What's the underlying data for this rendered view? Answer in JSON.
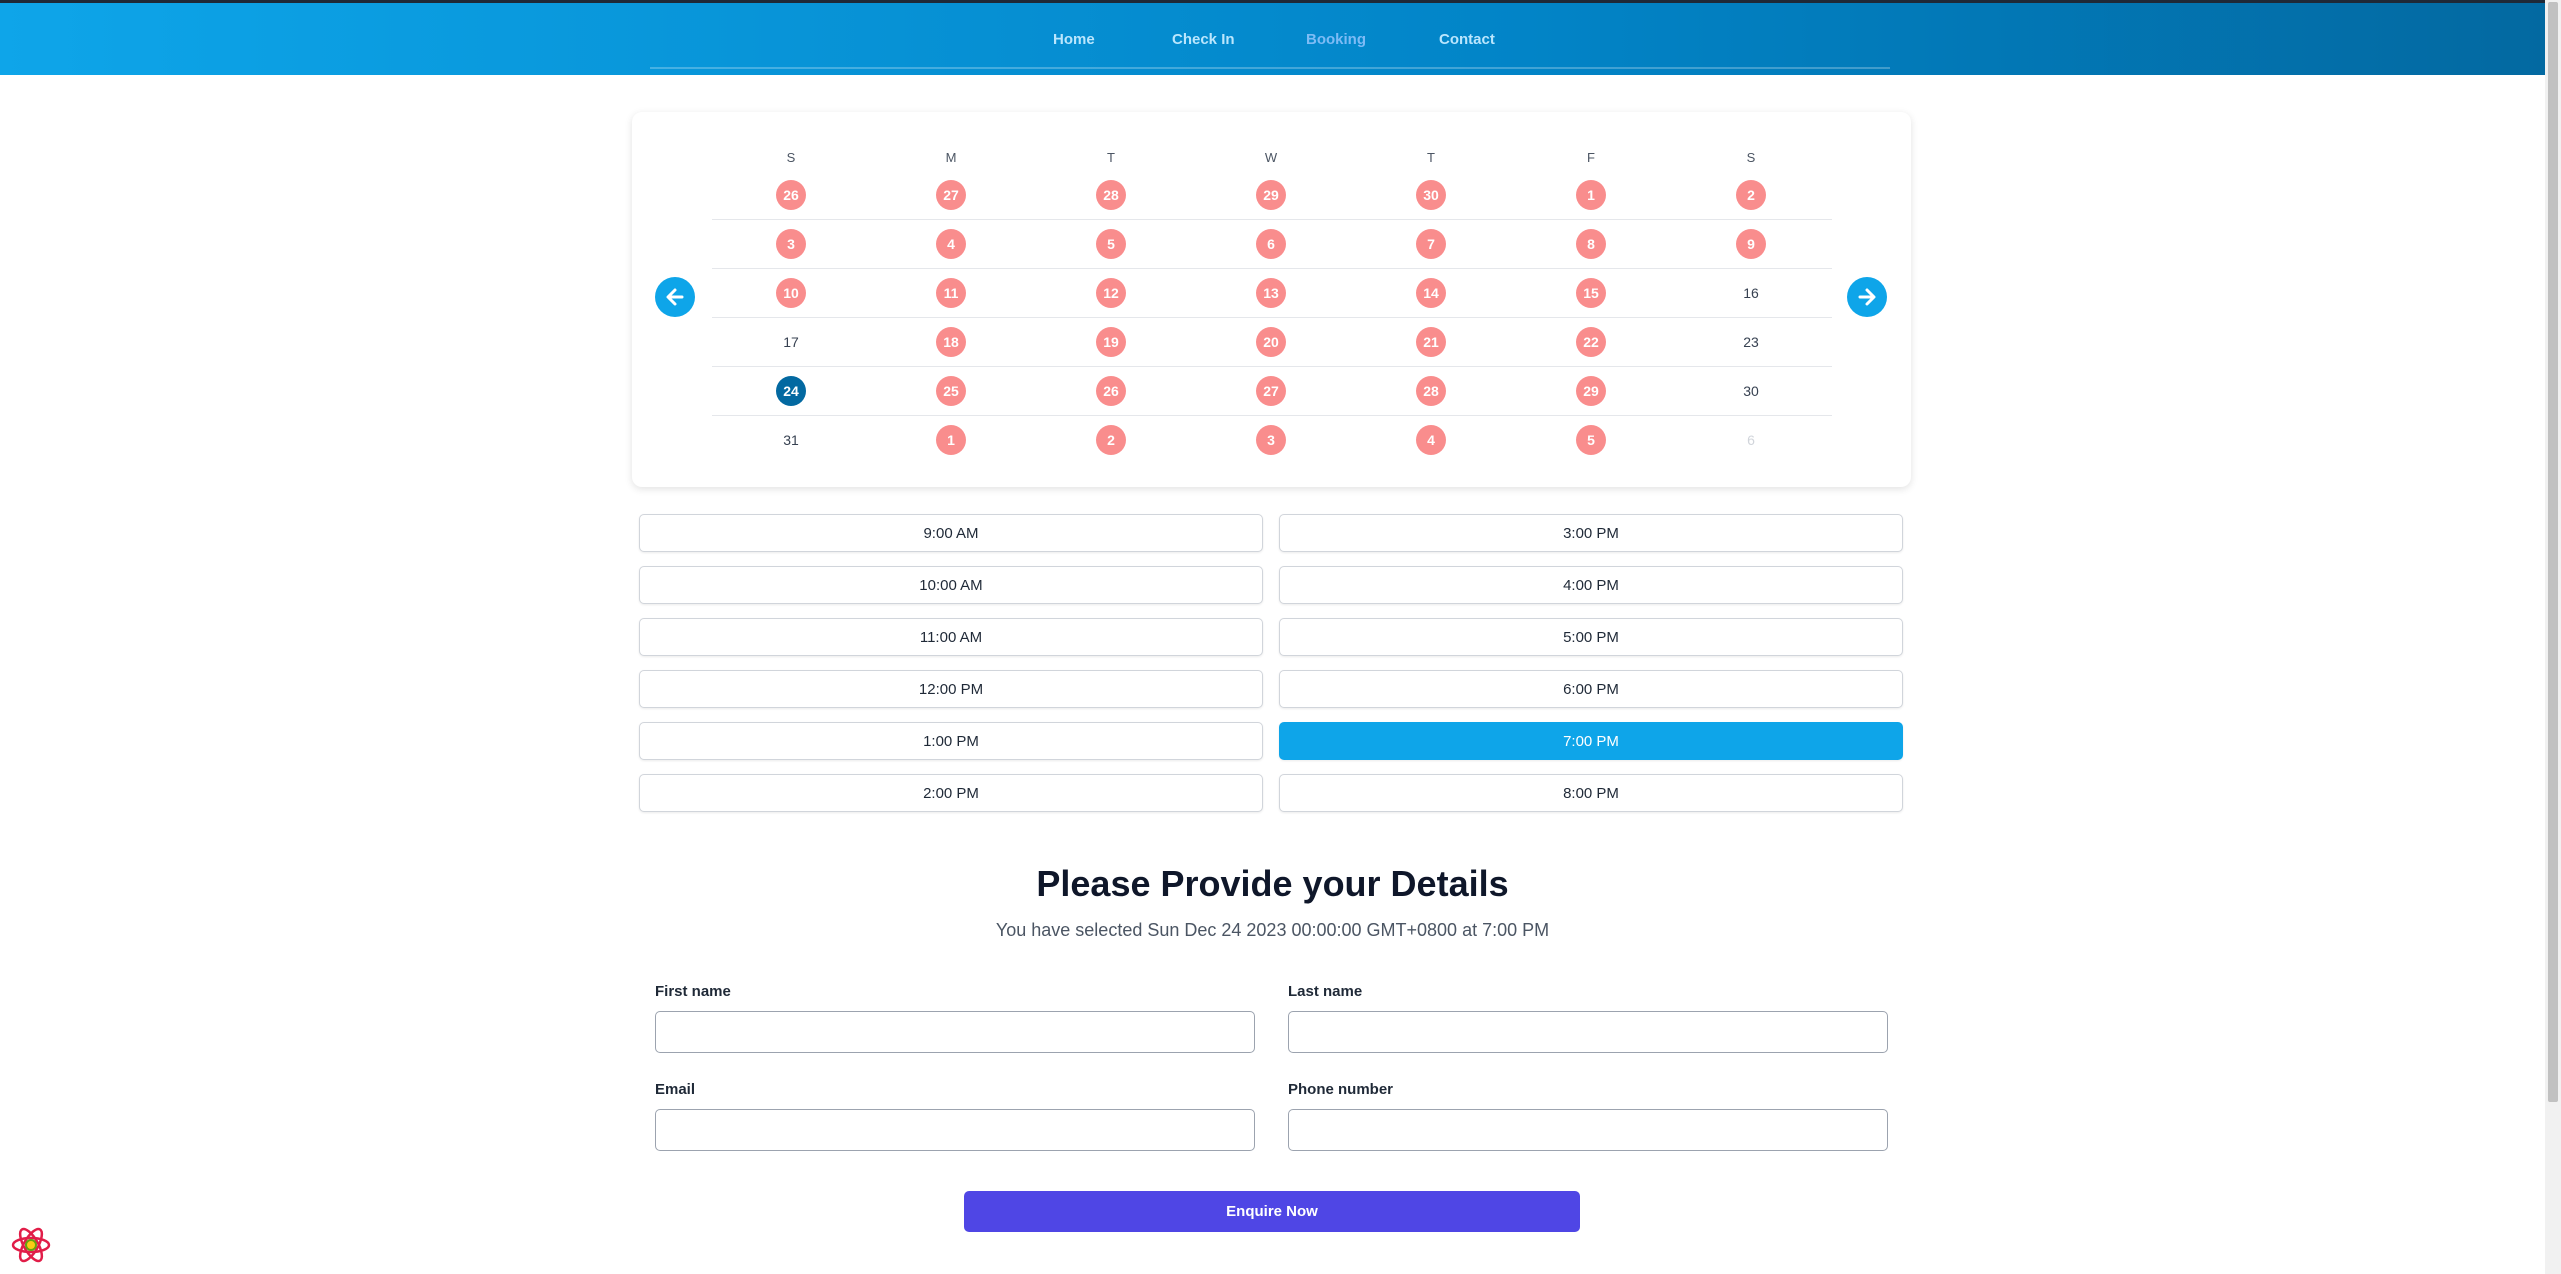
{
  "nav": {
    "items": [
      {
        "label": "Home"
      },
      {
        "label": "Check In"
      },
      {
        "label": "Booking"
      },
      {
        "label": "Contact"
      }
    ]
  },
  "calendar": {
    "weekdays": [
      "S",
      "M",
      "T",
      "W",
      "T",
      "F",
      "S"
    ],
    "weeks": [
      [
        {
          "d": "26",
          "s": "booked"
        },
        {
          "d": "27",
          "s": "booked"
        },
        {
          "d": "28",
          "s": "booked"
        },
        {
          "d": "29",
          "s": "booked"
        },
        {
          "d": "30",
          "s": "booked"
        },
        {
          "d": "1",
          "s": "booked"
        },
        {
          "d": "2",
          "s": "booked"
        }
      ],
      [
        {
          "d": "3",
          "s": "booked"
        },
        {
          "d": "4",
          "s": "booked"
        },
        {
          "d": "5",
          "s": "booked"
        },
        {
          "d": "6",
          "s": "booked"
        },
        {
          "d": "7",
          "s": "booked"
        },
        {
          "d": "8",
          "s": "booked"
        },
        {
          "d": "9",
          "s": "booked"
        }
      ],
      [
        {
          "d": "10",
          "s": "booked"
        },
        {
          "d": "11",
          "s": "booked"
        },
        {
          "d": "12",
          "s": "booked"
        },
        {
          "d": "13",
          "s": "booked"
        },
        {
          "d": "14",
          "s": "booked"
        },
        {
          "d": "15",
          "s": "booked"
        },
        {
          "d": "16",
          "s": "free"
        }
      ],
      [
        {
          "d": "17",
          "s": "free"
        },
        {
          "d": "18",
          "s": "booked"
        },
        {
          "d": "19",
          "s": "booked"
        },
        {
          "d": "20",
          "s": "booked"
        },
        {
          "d": "21",
          "s": "booked"
        },
        {
          "d": "22",
          "s": "booked"
        },
        {
          "d": "23",
          "s": "free"
        }
      ],
      [
        {
          "d": "24",
          "s": "selected"
        },
        {
          "d": "25",
          "s": "booked"
        },
        {
          "d": "26",
          "s": "booked"
        },
        {
          "d": "27",
          "s": "booked"
        },
        {
          "d": "28",
          "s": "booked"
        },
        {
          "d": "29",
          "s": "booked"
        },
        {
          "d": "30",
          "s": "free"
        }
      ],
      [
        {
          "d": "31",
          "s": "free"
        },
        {
          "d": "1",
          "s": "booked"
        },
        {
          "d": "2",
          "s": "booked"
        },
        {
          "d": "3",
          "s": "booked"
        },
        {
          "d": "4",
          "s": "booked"
        },
        {
          "d": "5",
          "s": "booked"
        },
        {
          "d": "6",
          "s": "muted"
        }
      ]
    ],
    "prev_icon": "arrow-left-icon",
    "next_icon": "arrow-right-icon"
  },
  "time_slots": {
    "left": [
      "9:00 AM",
      "10:00 AM",
      "11:00 AM",
      "12:00 PM",
      "1:00 PM",
      "2:00 PM"
    ],
    "right": [
      "3:00 PM",
      "4:00 PM",
      "5:00 PM",
      "6:00 PM",
      "7:00 PM",
      "8:00 PM"
    ],
    "selected": "7:00 PM"
  },
  "details": {
    "title": "Please Provide your Details",
    "subtitle": "You have selected Sun Dec 24 2023 00:00:00 GMT+0800 at 7:00 PM",
    "first_name_label": "First name",
    "last_name_label": "Last name",
    "email_label": "Email",
    "phone_label": "Phone number",
    "first_name_value": "",
    "last_name_value": "",
    "email_value": "",
    "phone_value": "",
    "submit_label": "Enquire Now"
  },
  "colors": {
    "header_start": "#0ea5e9",
    "header_end": "#0369a1",
    "booked_day": "#f87171",
    "selected_day": "#0369a1",
    "active_slot": "#0ea5e9",
    "submit_button": "#4f46e5"
  },
  "icons": {
    "dev_tool": "react-logo-icon"
  }
}
